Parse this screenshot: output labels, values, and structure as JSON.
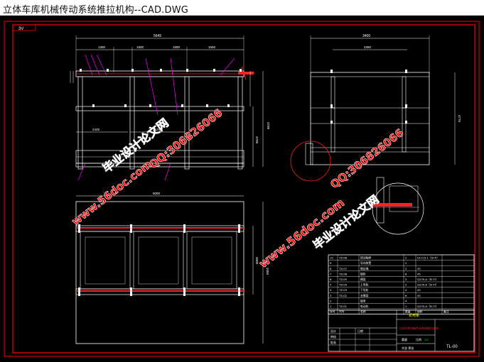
{
  "window": {
    "title": "立体车库机械传动系统推拉机构--CAD.DWG"
  },
  "drawing": {
    "corner_tag": "3V",
    "dim_labels": {
      "top_overall": "5645",
      "top_right": "3400",
      "top_right_inner": "2350",
      "left_height_1": "3708",
      "left_height_2": "3708",
      "right_height": "4775",
      "mid_span_left": "2445",
      "mid_span_right": "2525",
      "bottom_width": "6000",
      "bottom_height": "3450",
      "bottom_height_2": "3008",
      "seg_1": "1350",
      "seg_2": "1500",
      "seg_3": "1500",
      "seg_4": "1500"
    },
    "watermarks": [
      "毕业设计论文网",
      "www.56doc.com",
      "QQ:306826066",
      "www.56doc.com",
      "QQ:306826066",
      "毕业设计论文网"
    ],
    "bom": {
      "rows": [
        {
          "no": "10",
          "code": "TZ-08",
          "name": "转动轴承",
          "qty": "2",
          "material": "GCr15-1（Si-Ti）",
          "note": ""
        },
        {
          "no": "9",
          "code": "",
          "name": "导向装置",
          "qty": "2",
          "material": "",
          "note": ""
        },
        {
          "no": "8",
          "code": "TZ-07",
          "name": "钢丝绳",
          "qty": "2",
          "material": "45",
          "note": ""
        },
        {
          "no": "7",
          "code": "TZ-06",
          "name": "链轮",
          "qty": "8",
          "material": "45",
          "note": ""
        },
        {
          "no": "6",
          "code": "TZ-05",
          "name": "横梁",
          "qty": "2",
          "material": "Q235-A（Si-Ti）",
          "note": ""
        },
        {
          "no": "5",
          "code": "TZ-04",
          "name": "上导轨",
          "qty": "2",
          "material": "Q235-A（Si-Ti）",
          "note": ""
        },
        {
          "no": "4",
          "code": "TZ-03",
          "name": "下导轨",
          "qty": "4",
          "material": "45",
          "note": ""
        },
        {
          "no": "3",
          "code": "TZ-02",
          "name": "支撑架",
          "qty": "6",
          "material": "45",
          "note": ""
        },
        {
          "no": "2",
          "code": "",
          "name": "链条",
          "qty": "4",
          "material": "",
          "note": ""
        },
        {
          "no": "1",
          "code": "TZ-01",
          "name": "电动机",
          "qty": "1",
          "material": "Q235-A（Si-Ti）",
          "note": ""
        }
      ],
      "header": {
        "no": "序号",
        "code": "代号",
        "name": "名称",
        "qty": "数量",
        "material": "材料",
        "note": "备注"
      }
    },
    "title_block": {
      "school": "机电系",
      "drawing_title": "立体车库机械传动系统推拉机构",
      "drawing_no": "TL-00",
      "scale": "1:5",
      "labels": {
        "design": "设计",
        "check": "审核",
        "approve": "批准",
        "date": "日期",
        "sheet": "共张 第张",
        "weight": "重量",
        "scale_label": "比例"
      }
    },
    "colors": {
      "background": "#000000",
      "frame": "#ff0000",
      "lines": "#ffffff",
      "dims": "#ff00ff",
      "centerline": "#00ffff",
      "accent": "#ff2020",
      "green": "#00ff00",
      "yellow": "#ffff00",
      "watermark": "#ff0000"
    }
  }
}
